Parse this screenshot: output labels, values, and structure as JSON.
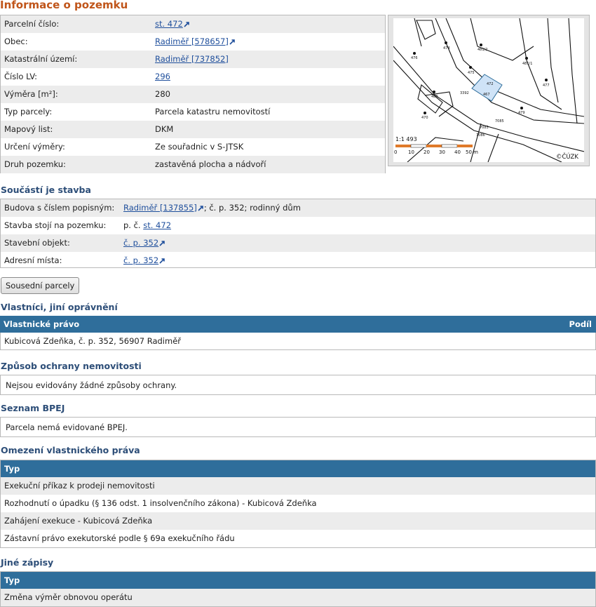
{
  "title": "Informace o pozemku",
  "parcel": {
    "rows": [
      {
        "label": "Parcelní číslo:",
        "value": "st. 472",
        "link": true
      },
      {
        "label": "Obec:",
        "value": "Radiměř [578657]",
        "link": true
      },
      {
        "label": "Katastrální území:",
        "value": "Radiměř [737852]",
        "link": true
      },
      {
        "label": "Číslo LV:",
        "value": "296",
        "link": true
      },
      {
        "label": "Výměra [m²]:",
        "value": "280",
        "link": false
      },
      {
        "label": "Typ parcely:",
        "value": "Parcela katastru nemovitostí",
        "link": false
      },
      {
        "label": "Mapový list:",
        "value": "DKM",
        "link": false
      },
      {
        "label": "Určení výměry:",
        "value": "Ze souřadnic v S-JTSK",
        "link": false
      },
      {
        "label": "Druh pozemku:",
        "value": "zastavěná plocha a nádvoří",
        "link": false
      }
    ]
  },
  "map": {
    "scale": "1:1 493",
    "scale_ticks": [
      "0",
      "10",
      "20",
      "30",
      "40",
      "50 m"
    ],
    "copyright": "©ČÚZK",
    "parcel_label": "472",
    "labels": [
      "474",
      "481/2",
      "481/1",
      "475",
      "476",
      "477",
      "479",
      "480",
      "467",
      "470",
      "3392",
      "7083",
      "7085",
      "7086"
    ]
  },
  "stavba": {
    "heading": "Součástí je stavba",
    "rows": [
      {
        "label": "Budova s číslem popisným:",
        "link": "Radiměř [137855]",
        "rest": "; č. p. 352; rodinný dům"
      },
      {
        "label": "Stavba stojí na pozemku:",
        "prefix": "p. č. ",
        "link": "st. 472"
      },
      {
        "label": "Stavební objekt:",
        "link": "č. p. 352"
      },
      {
        "label": "Adresní místa:",
        "link": "č. p. 352"
      }
    ]
  },
  "button_sousedni": "Sousední parcely",
  "vlastnici": {
    "heading": "Vlastníci, jiní oprávnění",
    "col1": "Vlastnické právo",
    "col2": "Podíl",
    "rows": [
      "Kubicová Zdeňka, č. p. 352, 56907 Radiměř"
    ]
  },
  "ochrana": {
    "heading": "Způsob ochrany nemovitosti",
    "text": "Nejsou evidovány žádné způsoby ochrany."
  },
  "bpej": {
    "heading": "Seznam BPEJ",
    "text": "Parcela nemá evidované BPEJ."
  },
  "omezeni": {
    "heading": "Omezení vlastnického práva",
    "col": "Typ",
    "rows": [
      "Exekuční příkaz k prodeji nemovitosti",
      "Rozhodnutí o úpadku (§ 136 odst. 1 insolvenčního zákona) - Kubicová Zdeňka",
      "Zahájení exekuce - Kubicová Zdeňka",
      "Zástavní právo exekutorské podle § 69a exekučního řádu"
    ]
  },
  "jine": {
    "heading": "Jiné zápisy",
    "col": "Typ",
    "rows": [
      "Změna výměr obnovou operátu"
    ]
  },
  "colors": {
    "title": "#c0551a",
    "heading": "#2d4e78",
    "table_header": "#2f6e9b",
    "link": "#1f4f9c",
    "row_alt": "#ececec",
    "parcel_fill": "#cfe3f7"
  }
}
